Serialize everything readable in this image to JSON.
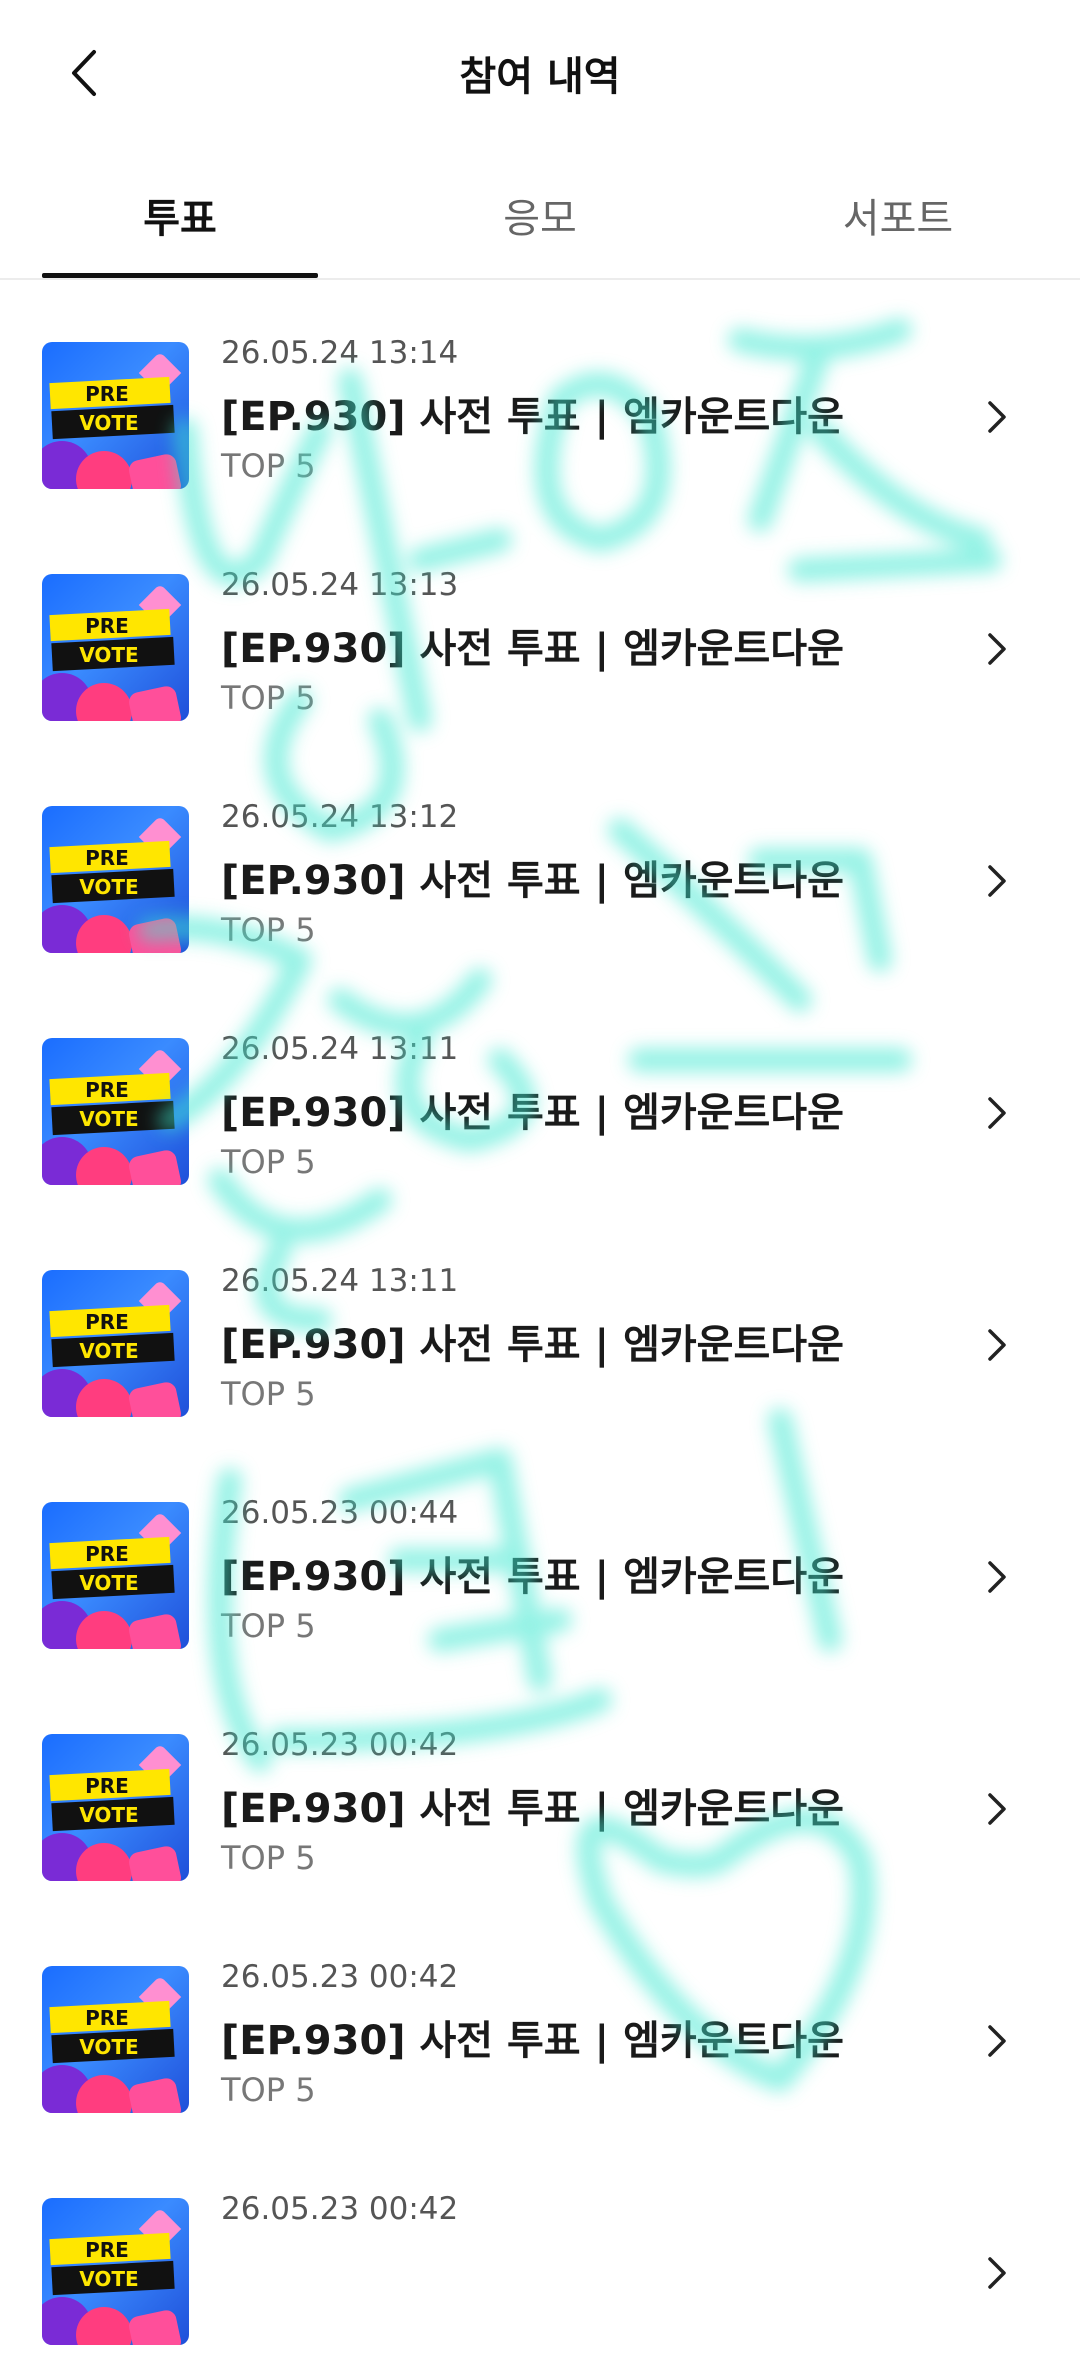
{
  "header": {
    "title": "참여 내역"
  },
  "tabs": [
    {
      "label": "투표",
      "active": true
    },
    {
      "label": "응모",
      "active": false
    },
    {
      "label": "서포트",
      "active": false
    }
  ],
  "thumbnail": {
    "line1": "PRE",
    "line2": "VOTE"
  },
  "items": [
    {
      "date": "26.05.24 13:14",
      "title": "[EP.930] 사전 투표 | 엠카운트다운",
      "subtitle": "TOP 5"
    },
    {
      "date": "26.05.24 13:13",
      "title": "[EP.930] 사전 투표 | 엠카운트다운",
      "subtitle": "TOP 5"
    },
    {
      "date": "26.05.24 13:12",
      "title": "[EP.930] 사전 투표 | 엠카운트다운",
      "subtitle": "TOP 5"
    },
    {
      "date": "26.05.24 13:11",
      "title": "[EP.930] 사전 투표 | 엠카운트다운",
      "subtitle": "TOP 5"
    },
    {
      "date": "26.05.24 13:11",
      "title": "[EP.930] 사전 투표 | 엠카운트다운",
      "subtitle": "TOP 5"
    },
    {
      "date": "26.05.23 00:44",
      "title": "[EP.930] 사전 투표 | 엠카운트다운",
      "subtitle": "TOP 5"
    },
    {
      "date": "26.05.23 00:42",
      "title": "[EP.930] 사전 투표 | 엠카운트다운",
      "subtitle": "TOP 5"
    },
    {
      "date": "26.05.23 00:42",
      "title": "[EP.930] 사전 투표 | 엠카운트다운",
      "subtitle": "TOP 5"
    },
    {
      "date": "26.05.23 00:42",
      "title": "",
      "subtitle": ""
    }
  ],
  "colors": {
    "accent": "#111111",
    "scribble": "#3ee8d0"
  },
  "icons": {
    "back": "chevron-left-icon",
    "row_action": "chevron-right-icon"
  }
}
